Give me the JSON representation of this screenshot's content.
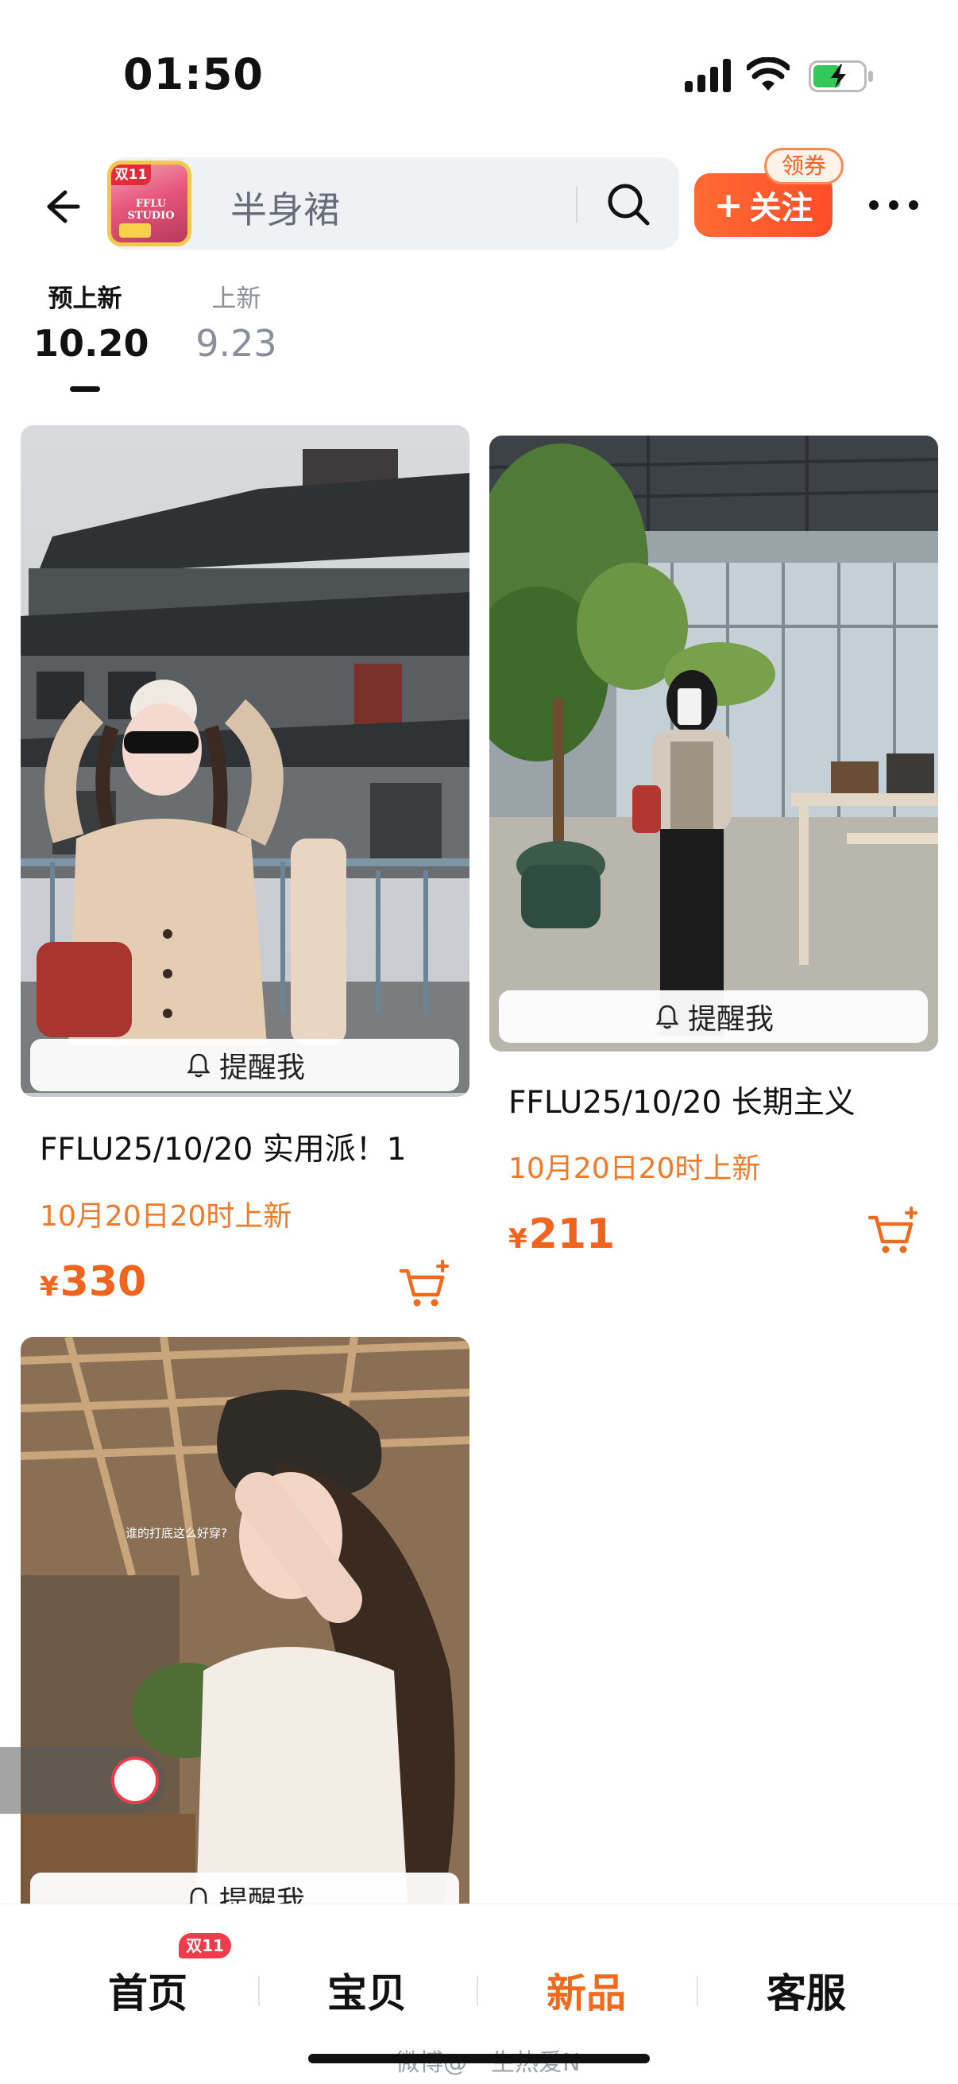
{
  "status_bar": {
    "time": "01:50"
  },
  "header": {
    "store_logo": {
      "tag": "双11",
      "text": "FFLU STUDIO"
    },
    "search_placeholder": "半身裙",
    "follow_label": "关注",
    "coupon_label": "领券"
  },
  "date_tabs": [
    {
      "label": "预上新",
      "value": "10.20",
      "active": true
    },
    {
      "label": "上新",
      "value": "9.23",
      "active": false
    }
  ],
  "products": [
    {
      "title": "FFLU25/10/20 实用派！1",
      "release": "10月20日20时上新",
      "currency": "¥",
      "price": "330",
      "remind_label": "提醒我",
      "overlay_text": ""
    },
    {
      "title": "FFLU25/10/20 长期主义",
      "release": "10月20日20时上新",
      "currency": "¥",
      "price": "211",
      "remind_label": "提醒我",
      "overlay_text": ""
    },
    {
      "title": "",
      "release": "",
      "currency": "",
      "price": "",
      "remind_label": "提醒我",
      "overlay_text": "谁的打底这么好穿?"
    }
  ],
  "bottom_nav": {
    "items": [
      {
        "label": "首页",
        "badge": "双11",
        "active": false
      },
      {
        "label": "宝贝",
        "active": false
      },
      {
        "label": "新品",
        "active": true
      },
      {
        "label": "客服",
        "active": false
      }
    ]
  },
  "watermark": "微博@一生热爱N",
  "colors": {
    "accent": "#f06a1e",
    "price": "#f0641e",
    "release": "#f07a2a",
    "follow_button": "#ff5a2a",
    "badge_red": "#f03b4a"
  }
}
